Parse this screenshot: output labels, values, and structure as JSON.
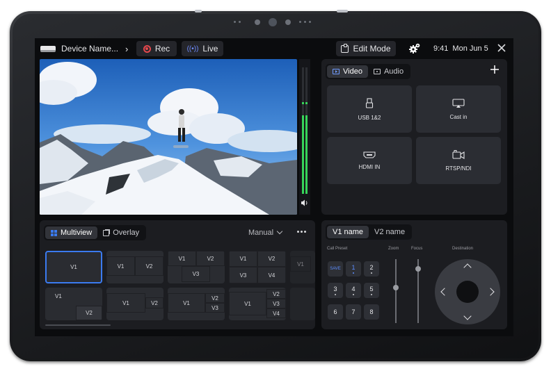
{
  "status_bar": {
    "device_name": "Device Name...",
    "rec_label": "Rec",
    "live_label": "Live",
    "edit_mode_label": "Edit Mode",
    "time": "9:41",
    "date": "Mon Jun 5"
  },
  "colors": {
    "rec_red": "#e5484d",
    "live_blue": "#6f8cff",
    "accent_blue": "#3b7bf0",
    "meter_green": "#37d45a"
  },
  "audio_meter": {
    "left_level": 0.62,
    "right_level": 0.62
  },
  "source_panel": {
    "tabs": [
      {
        "label": "Video",
        "active": true
      },
      {
        "label": "Audio",
        "active": false
      }
    ],
    "sources": [
      {
        "label": "USB 1&2",
        "icon": "usb-icon"
      },
      {
        "label": "Cast in",
        "icon": "cast-icon"
      },
      {
        "label": "HDMI IN",
        "icon": "hdmi-icon"
      },
      {
        "label": "RTSP/NDI",
        "icon": "camera-icon"
      }
    ]
  },
  "layout_panel": {
    "tabs": [
      {
        "label": "Multiview",
        "active": true
      },
      {
        "label": "Overlay",
        "active": false
      }
    ],
    "mode": "Manual",
    "layouts_row1": [
      [
        "V1"
      ],
      [
        "V1",
        "V2"
      ],
      [
        "V1",
        "V2",
        "V3"
      ],
      [
        "V1",
        "V2",
        "V3",
        "V4"
      ],
      [
        "V1"
      ]
    ],
    "layouts_row2": [
      [
        "V1",
        "V2"
      ],
      [
        "V1",
        "V2"
      ],
      [
        "V1",
        "V2",
        "V3"
      ],
      [
        "V1",
        "V2",
        "V3",
        "V4"
      ]
    ]
  },
  "camera_panel": {
    "tabs": [
      {
        "label": "V1 name",
        "active": true
      },
      {
        "label": "V2 name",
        "active": false
      }
    ],
    "call_preset_label": "Call Preset",
    "zoom_label": "Zoom",
    "focus_label": "Focus",
    "destination_label": "Destination",
    "keypad": [
      "SAVE",
      "1",
      "2",
      "3",
      "4",
      "5",
      "6",
      "7",
      "8"
    ],
    "zoom_level": 0.45,
    "focus_level": 0.15
  }
}
